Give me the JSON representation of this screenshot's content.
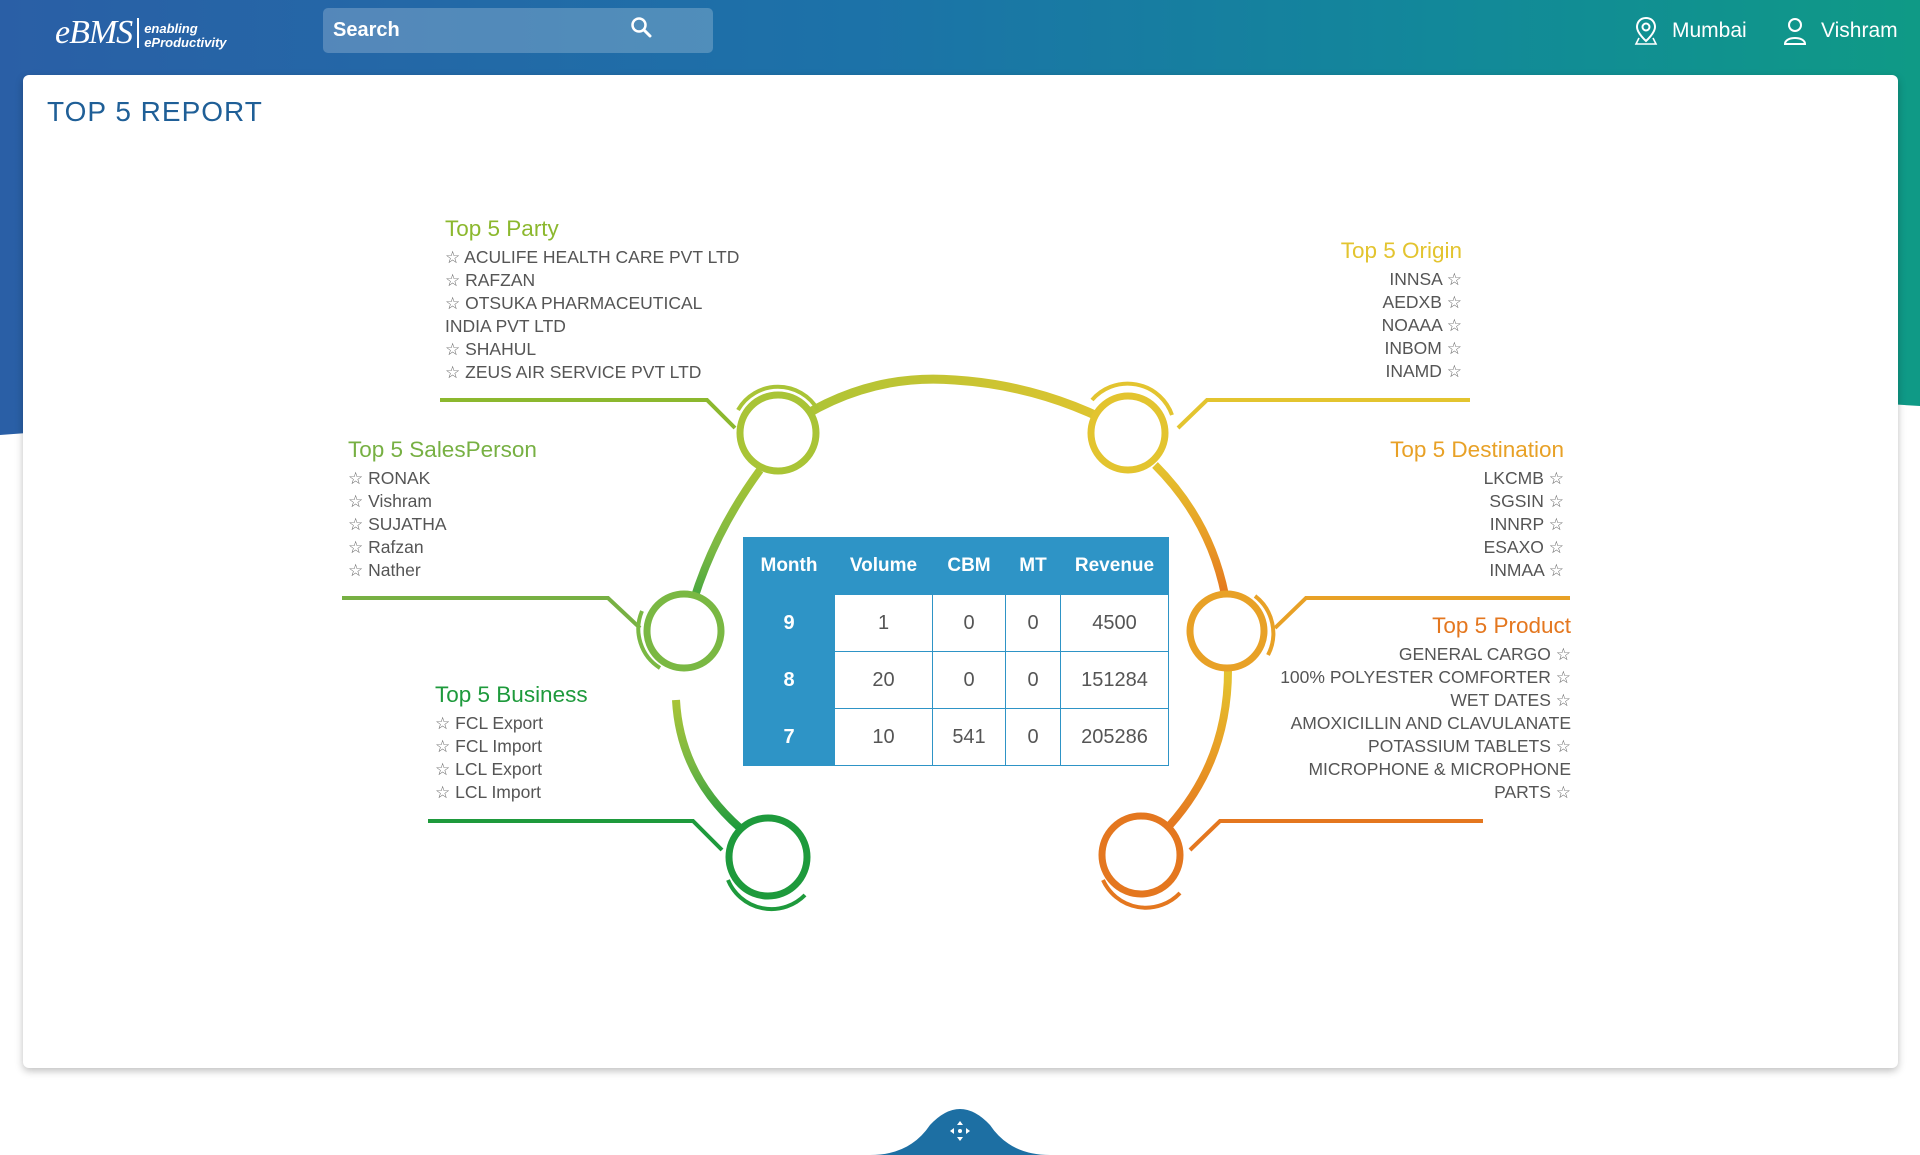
{
  "header": {
    "logo_text": "eBMS",
    "logo_tagline_1": "enabling",
    "logo_tagline_2": "eProductivity",
    "search_placeholder": "Search",
    "location": "Mumbai",
    "user": "Vishram"
  },
  "page_title": "TOP 5 REPORT",
  "groups": {
    "party": {
      "title": "Top 5 Party",
      "color": "#8cb82e",
      "items": [
        "ACULIFE HEALTH CARE PVT LTD",
        "RAFZAN",
        "OTSUKA PHARMACEUTICAL",
        "INDIA PVT LTD",
        "SHAHUL",
        "ZEUS AIR SERVICE PVT LTD"
      ]
    },
    "salesperson": {
      "title": "Top 5 SalesPerson",
      "color": "#77b043",
      "items": [
        "RONAK",
        "Vishram",
        "SUJATHA",
        "Rafzan",
        "Nather"
      ]
    },
    "business": {
      "title": "Top 5 Business",
      "color": "#1e9a3c",
      "items": [
        "FCL Export",
        "FCL Import",
        "LCL Export",
        "LCL Import"
      ]
    },
    "origin": {
      "title": "Top 5 Origin",
      "color": "#e3c42f",
      "items": [
        "INNSA",
        "AEDXB",
        "NOAAA",
        "INBOM",
        "INAMD"
      ]
    },
    "destination": {
      "title": "Top 5 Destination",
      "color": "#e8a126",
      "items": [
        "LKCMB",
        "SGSIN",
        "INNRP",
        "ESAXO",
        "INMAA"
      ]
    },
    "product": {
      "title": "Top 5 Product",
      "color": "#e4771f",
      "items": [
        "GENERAL CARGO",
        "100% POLYESTER COMFORTER",
        "WET DATES",
        "AMOXICILLIN AND CLAVULANATE",
        "POTASSIUM TABLETS",
        "MICROPHONE & MICROPHONE",
        "PARTS"
      ]
    }
  },
  "table": {
    "headers": [
      "Month",
      "Volume",
      "CBM",
      "MT",
      "Revenue"
    ],
    "rows": [
      [
        "9",
        "1",
        "0",
        "0",
        "4500"
      ],
      [
        "8",
        "20",
        "0",
        "0",
        "151284"
      ],
      [
        "7",
        "10",
        "541",
        "0",
        "205286"
      ]
    ]
  },
  "icons": {
    "search": "search-icon",
    "location": "location-pin-icon",
    "user": "user-icon",
    "star": "star-outline-icon",
    "bottom_nav": "move-arrows-icon"
  },
  "colors": {
    "header_start": "#2a5fa6",
    "header_end": "#0f9a86",
    "title": "#1f5f97",
    "table_header": "#2e94c6"
  }
}
